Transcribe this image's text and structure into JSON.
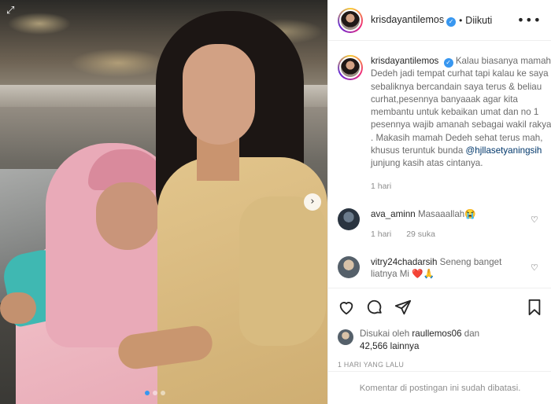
{
  "post": {
    "image_alt": "",
    "carousel": {
      "total": 3,
      "active": 1
    }
  },
  "header": {
    "username": "krisdayantilemos",
    "separator": "•",
    "follow_status": "Diikuti",
    "more_label": "•••",
    "verified_icon": "verified-badge-icon"
  },
  "caption": {
    "username": "krisdayantilemos",
    "text_before_mention": "Kalau biasanya mamah Dedeh jadi tempat curhat tapi kalau ke saya sebaliknya bercandain saya terus & beliau curhat,pesennya banyaaak agar kita membantu untuk kebaikan umat dan no 1 pesennya wajib amanah sebagai wakil rakyat . Makasih mamah Dedeh sehat terus mah, khusus teruntuk bunda ",
    "mention": "@hjllasetyaningsih",
    "text_after_mention": " junjung kasih atas cintanya.",
    "time": "1 hari"
  },
  "comments": [
    {
      "username": "ava_aminn",
      "text": "Masaaallah😭",
      "time": "1 hari",
      "likes": "29 suka"
    },
    {
      "username": "vitry24chadarsih",
      "text": "Seneng banget liatnya Mi ❤️🙏"
    }
  ],
  "actions": {
    "like_icon": "heart-icon",
    "comment_icon": "comment-icon",
    "share_icon": "paper-plane-icon",
    "save_icon": "bookmark-icon"
  },
  "likes": {
    "prefix": "Disukai oleh ",
    "user": "raullemos06",
    "middle": " dan",
    "count": "42,566 lainnya"
  },
  "timestamp": "1 HARI YANG LALU",
  "footer": {
    "comments_disabled": "Komentar di postingan ini sudah dibatasi."
  },
  "colors": {
    "link": "#00376b",
    "verified": "#3897f0",
    "carousel_active": "#3797f0"
  }
}
